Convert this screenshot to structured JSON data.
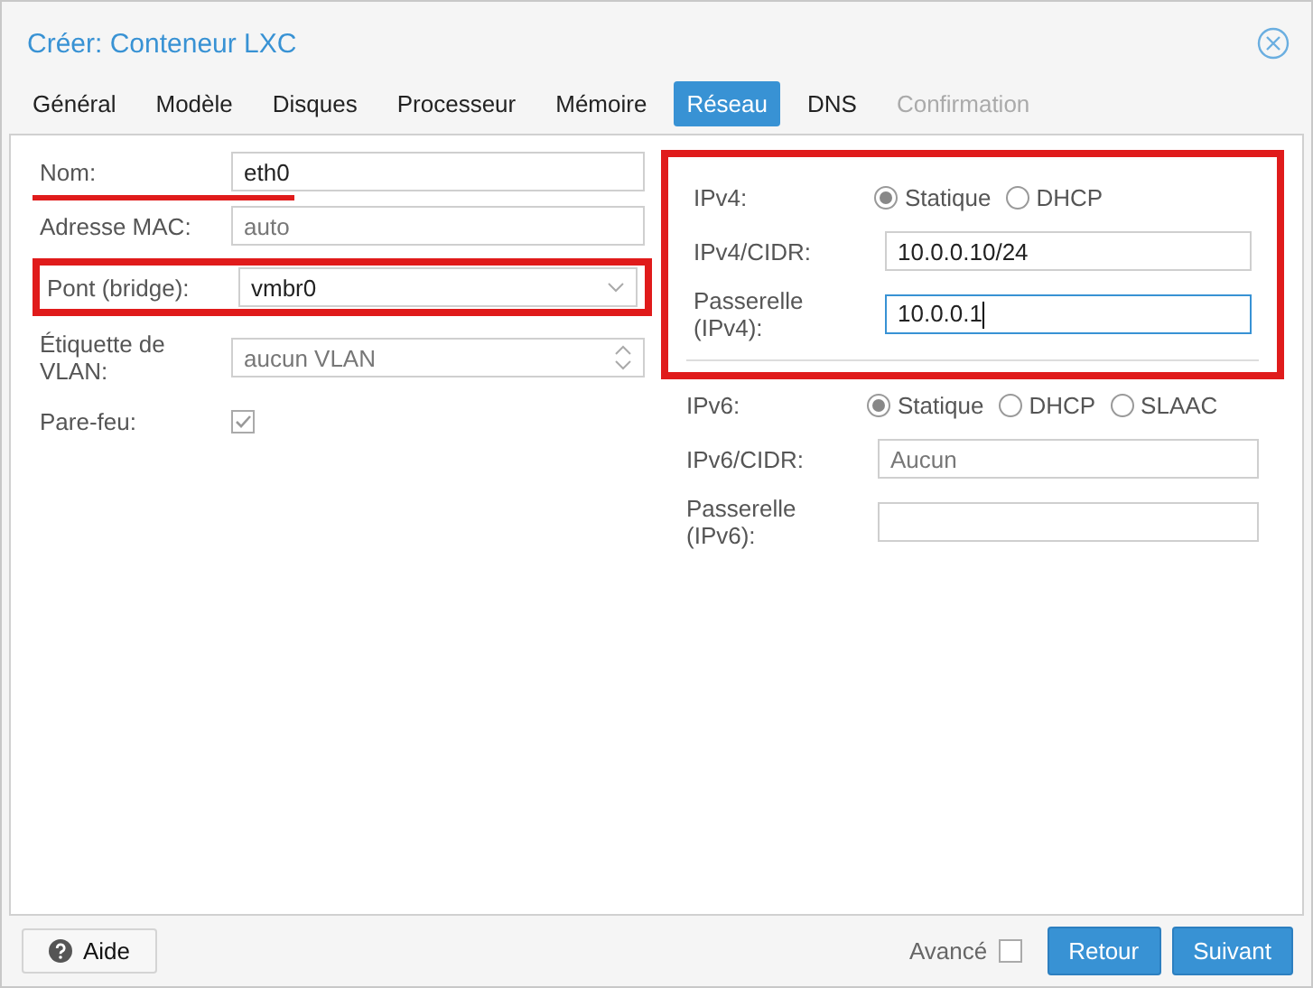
{
  "window": {
    "title": "Créer: Conteneur LXC"
  },
  "tabs": [
    {
      "label": "Général",
      "selected": false,
      "disabled": false
    },
    {
      "label": "Modèle",
      "selected": false,
      "disabled": false
    },
    {
      "label": "Disques",
      "selected": false,
      "disabled": false
    },
    {
      "label": "Processeur",
      "selected": false,
      "disabled": false
    },
    {
      "label": "Mémoire",
      "selected": false,
      "disabled": false
    },
    {
      "label": "Réseau",
      "selected": true,
      "disabled": false
    },
    {
      "label": "DNS",
      "selected": false,
      "disabled": false
    },
    {
      "label": "Confirmation",
      "selected": false,
      "disabled": true
    }
  ],
  "left": [
    {
      "kind": "text",
      "label": "Nom:",
      "value": "eth0",
      "underlined": true,
      "boxed": false
    },
    {
      "kind": "text",
      "label": "Adresse MAC:",
      "placeholder": "auto",
      "underlined": false,
      "boxed": false
    },
    {
      "kind": "combo",
      "label": "Pont (bridge):",
      "value": "vmbr0",
      "underlined": false,
      "boxed": true
    },
    {
      "kind": "spinner",
      "label": "Étiquette de VLAN:",
      "placeholder": "aucun VLAN",
      "underlined": false,
      "boxed": false
    },
    {
      "kind": "checkbox",
      "label": "Pare-feu:",
      "checked": true,
      "underlined": false,
      "boxed": false
    }
  ],
  "right": [
    {
      "annotated": true,
      "rows": [
        {
          "kind": "radio",
          "label": "IPv4:",
          "options": [
            {
              "label": "Statique",
              "selected": true
            },
            {
              "label": "DHCP",
              "selected": false
            }
          ]
        },
        {
          "kind": "text",
          "label": "IPv4/CIDR:",
          "value": "10.0.0.10/24",
          "focused": false
        },
        {
          "kind": "text",
          "label": "Passerelle (IPv4):",
          "value": "10.0.0.1",
          "focused": true
        }
      ]
    },
    {
      "annotated": false,
      "rows": [
        {
          "kind": "radio",
          "label": "IPv6:",
          "options": [
            {
              "label": "Statique",
              "selected": true
            },
            {
              "label": "DHCP",
              "selected": false
            },
            {
              "label": "SLAAC",
              "selected": false
            }
          ]
        },
        {
          "kind": "text",
          "label": "IPv6/CIDR:",
          "placeholder": "Aucun",
          "focused": false
        },
        {
          "kind": "text",
          "label": "Passerelle (IPv6):",
          "focused": false
        }
      ]
    }
  ],
  "footer": {
    "help": "Aide",
    "advanced": {
      "label": "Avancé",
      "checked": false
    },
    "buttons": [
      "Retour",
      "Suivant"
    ]
  }
}
